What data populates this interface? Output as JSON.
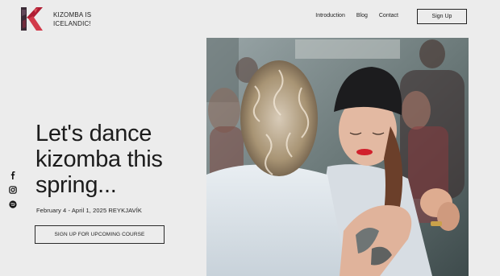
{
  "header": {
    "brand_name": "KIZOMBA IS ICELANDIC!",
    "nav": [
      {
        "label": "Introduction"
      },
      {
        "label": "Blog"
      },
      {
        "label": "Contact"
      }
    ],
    "signup_label": "Sign Up",
    "logo_icon": "k-letter-logo-icon"
  },
  "hero": {
    "title": "Let's dance kizomba this spring...",
    "dates": "February 4 - April 1, 2025 REYKJAVÍK",
    "cta_label": "SIGN UP FOR UPCOMING COURSE"
  },
  "social": [
    {
      "icon": "facebook-icon"
    },
    {
      "icon": "instagram-icon"
    },
    {
      "icon": "spotify-icon"
    }
  ],
  "colors": {
    "background": "#ececec",
    "text": "#1a1a1a",
    "logo_accent": "#c4152a"
  }
}
